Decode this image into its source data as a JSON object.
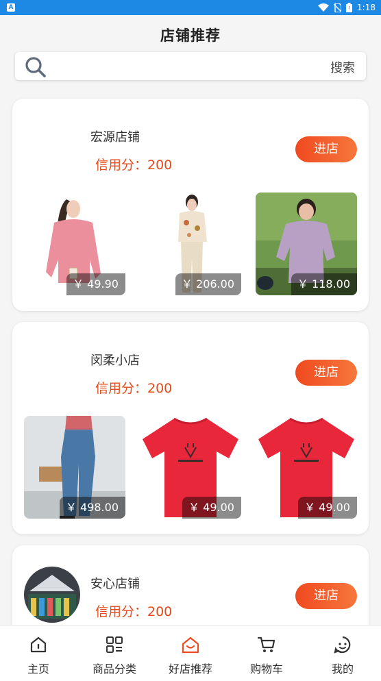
{
  "status_bar": {
    "app_badge": "A",
    "time": "1:18"
  },
  "page": {
    "title": "店铺推荐"
  },
  "search": {
    "placeholder": "",
    "button_label": "搜索"
  },
  "shops": [
    {
      "name": "宏源店铺",
      "credit": "信用分：200",
      "enter_label": "进店",
      "products": [
        {
          "price": "￥ 49.90",
          "image": "pink-blouse"
        },
        {
          "price": "￥ 206.00",
          "image": "floral-two-piece"
        },
        {
          "price": "￥ 118.00",
          "image": "lilac-shirt"
        }
      ]
    },
    {
      "name": "闵柔小店",
      "credit": "信用分：200",
      "enter_label": "进店",
      "products": [
        {
          "price": "￥ 498.00",
          "image": "flare-jeans"
        },
        {
          "price": "￥ 49.00",
          "image": "red-tshirt"
        },
        {
          "price": "￥ 49.00",
          "image": "red-tshirt"
        }
      ]
    },
    {
      "name": "安心店铺",
      "credit": "信用分：200",
      "enter_label": "进店",
      "avatar": "store-interior"
    }
  ],
  "bottom_nav": [
    {
      "label": "主页",
      "icon": "home-icon"
    },
    {
      "label": "商品分类",
      "icon": "category-icon"
    },
    {
      "label": "好店推荐",
      "icon": "store-icon",
      "active": true
    },
    {
      "label": "购物车",
      "icon": "cart-icon"
    },
    {
      "label": "我的",
      "icon": "profile-icon"
    }
  ],
  "colors": {
    "status_bar": "#1e88e5",
    "accent": "#f04a20",
    "credit_text": "#e64a19",
    "active_nav": "#f04a20"
  }
}
